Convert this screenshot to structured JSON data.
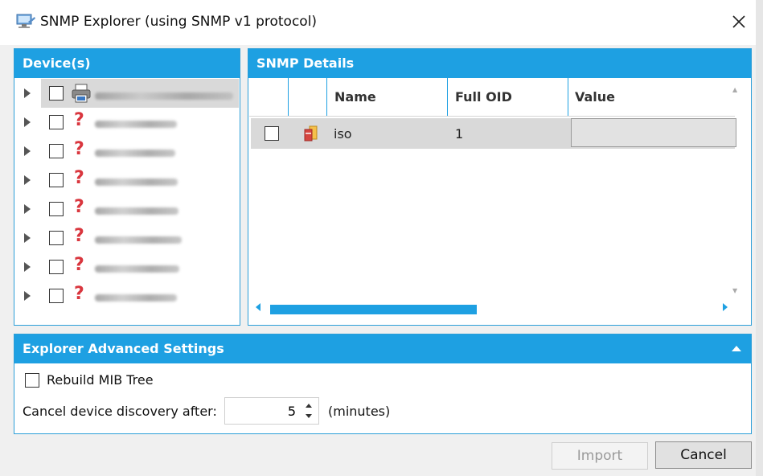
{
  "window": {
    "title": "SNMP Explorer (using SNMP v1 protocol)",
    "icon": "snmp-explorer-icon",
    "close_icon": "close-icon"
  },
  "devices": {
    "header": "Device(s)",
    "items": [
      {
        "icon": "printer-icon",
        "selected": true
      },
      {
        "icon": "question-icon",
        "selected": false
      },
      {
        "icon": "question-icon",
        "selected": false
      },
      {
        "icon": "question-icon",
        "selected": false
      },
      {
        "icon": "question-icon",
        "selected": false
      },
      {
        "icon": "question-icon",
        "selected": false
      },
      {
        "icon": "question-icon",
        "selected": false
      },
      {
        "icon": "question-icon",
        "selected": false
      }
    ],
    "question_glyph": "?"
  },
  "details": {
    "header": "SNMP Details",
    "columns": [
      "Name",
      "Full OID",
      "Value"
    ],
    "rows": [
      {
        "name": "iso",
        "oid": "1",
        "value": ""
      }
    ]
  },
  "advanced": {
    "header": "Explorer Advanced Settings",
    "rebuild_label": "Rebuild MIB Tree",
    "cancel_label": "Cancel device discovery after:",
    "cancel_value": "5",
    "unit_label": "(minutes)"
  },
  "buttons": {
    "import": "Import",
    "cancel": "Cancel"
  },
  "colors": {
    "accent": "#1ea0e2",
    "question": "#d9363e"
  }
}
